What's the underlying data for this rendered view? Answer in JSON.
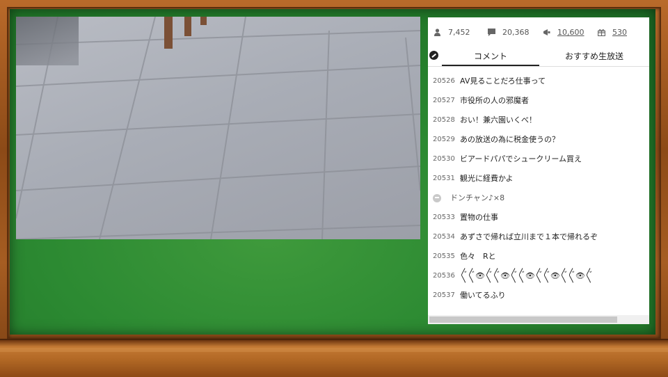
{
  "stats": {
    "viewers": "7,452",
    "comments": "20,368",
    "ad_points": "10,600",
    "gifts": "530"
  },
  "tabs": [
    {
      "label": "コメント",
      "active": true
    },
    {
      "label": "おすすめ生放送",
      "active": false
    }
  ],
  "comments": [
    {
      "num": "20526",
      "text": "AV見ることだろ仕事って"
    },
    {
      "num": "20527",
      "text": "市役所の人の邪魔者"
    },
    {
      "num": "20528",
      "text": "おい！兼六園いくべ！"
    },
    {
      "num": "20529",
      "text": "あの放送の為に税金使うの？"
    },
    {
      "num": "20530",
      "text": "ビアードパパでシュークリーム買え"
    },
    {
      "num": "20531",
      "text": "観光に経費かよ"
    },
    {
      "num": "",
      "text": "ドンチャン♪×8",
      "gift": true
    },
    {
      "num": "20533",
      "text": "置物の仕事"
    },
    {
      "num": "20534",
      "text": "あずさで帰れば立川まで１本で帰れるぞ"
    },
    {
      "num": "20535",
      "text": "色々　Rと"
    },
    {
      "num": "20536",
      "text": "〴〵〴〵👁〴〵〴〵👁〴〵〴〵👁〴〵〴〵👁〴〵〴〵👁〴〵"
    },
    {
      "num": "20537",
      "text": "働いてるふり"
    }
  ],
  "colors": {
    "board": "#2c8a32",
    "frame": "#a65d22"
  }
}
